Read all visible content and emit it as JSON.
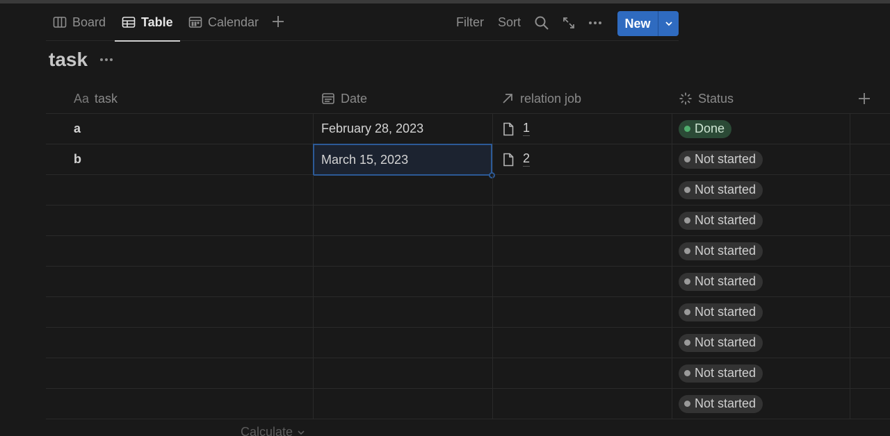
{
  "views": {
    "tabs": [
      {
        "label": "Board",
        "icon": "board-icon"
      },
      {
        "label": "Table",
        "icon": "table-icon"
      },
      {
        "label": "Calendar",
        "icon": "calendar-icon"
      }
    ],
    "active_tab": "Table"
  },
  "toolbar": {
    "filter_label": "Filter",
    "sort_label": "Sort",
    "new_label": "New"
  },
  "database": {
    "title": "task"
  },
  "columns": {
    "task_prefix": "Aa",
    "task": "task",
    "date": "Date",
    "relation": "relation job",
    "status": "Status"
  },
  "rows": [
    {
      "task": "a",
      "date": "February 28, 2023",
      "relation": "1",
      "status": "Done"
    },
    {
      "task": "b",
      "date": "March 15, 2023",
      "relation": "2",
      "status": "Not started"
    },
    {
      "task": "",
      "date": "",
      "relation": "",
      "status": "Not started"
    },
    {
      "task": "",
      "date": "",
      "relation": "",
      "status": "Not started"
    },
    {
      "task": "",
      "date": "",
      "relation": "",
      "status": "Not started"
    },
    {
      "task": "",
      "date": "",
      "relation": "",
      "status": "Not started"
    },
    {
      "task": "",
      "date": "",
      "relation": "",
      "status": "Not started"
    },
    {
      "task": "",
      "date": "",
      "relation": "",
      "status": "Not started"
    },
    {
      "task": "",
      "date": "",
      "relation": "",
      "status": "Not started"
    },
    {
      "task": "",
      "date": "",
      "relation": "",
      "status": "Not started"
    }
  ],
  "footer": {
    "calculate_label": "Calculate"
  },
  "colors": {
    "accent": "#2f6bc0",
    "done_badge": "#2b4a36",
    "not_started_badge": "#333333"
  }
}
